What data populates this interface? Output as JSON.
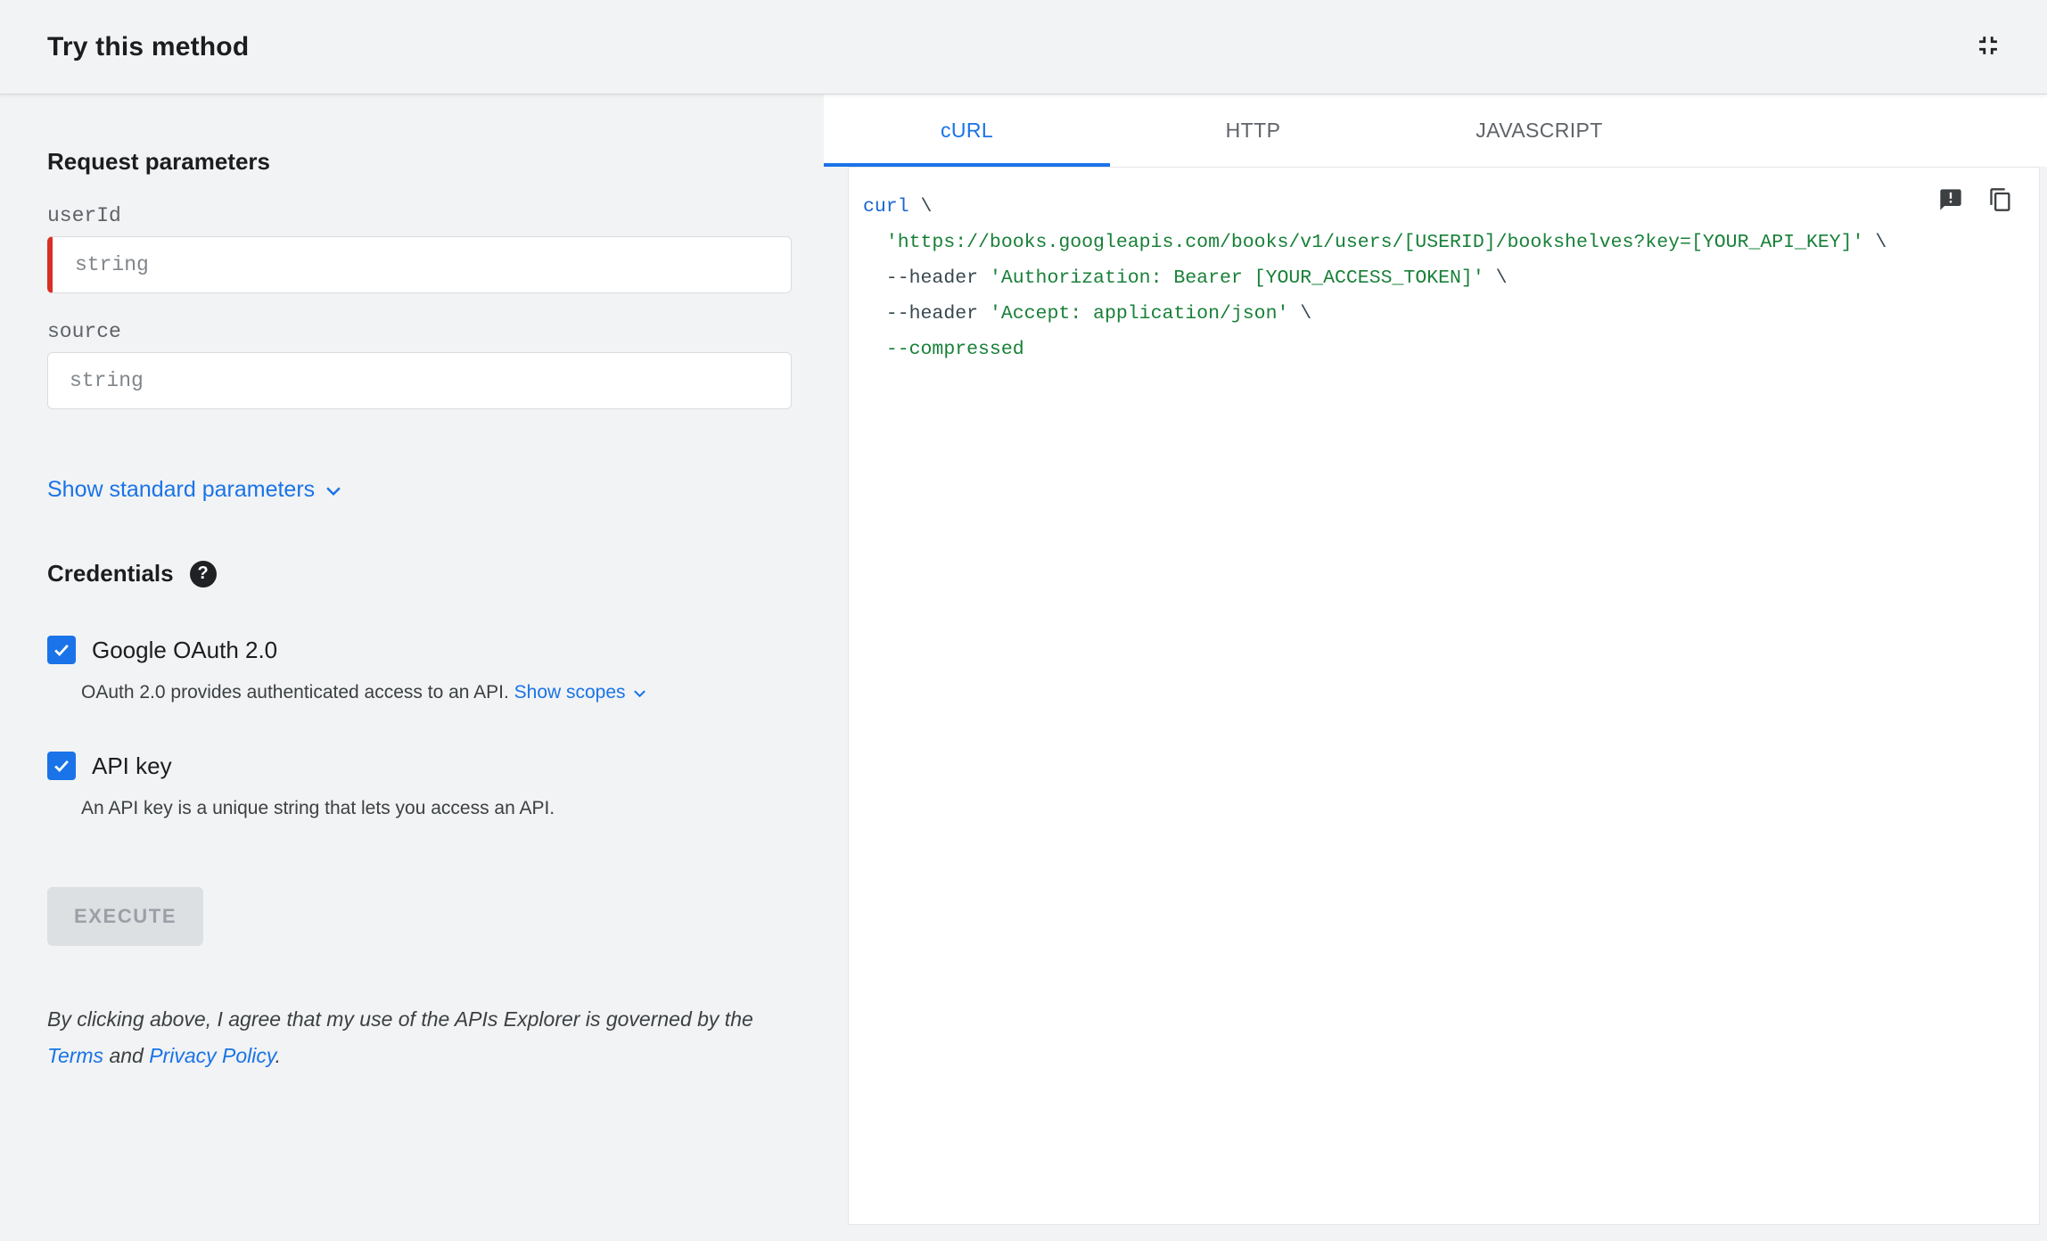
{
  "header": {
    "title": "Try this method"
  },
  "icons": {
    "collapse": "fullscreen-exit-icon",
    "help": "help-circle-icon",
    "feedback": "feedback-icon",
    "copy": "copy-icon",
    "chevron": "chevron-down-icon",
    "checkbox_checked": "checkbox-checked-icon"
  },
  "left": {
    "request_heading": "Request parameters",
    "fields": [
      {
        "label": "userId",
        "placeholder": "string",
        "required": true
      },
      {
        "label": "source",
        "placeholder": "string",
        "required": false
      }
    ],
    "show_standard_label": "Show standard parameters",
    "credentials_heading": "Credentials",
    "oauth": {
      "label": "Google OAuth 2.0",
      "checked": true,
      "description": "OAuth 2.0 provides authenticated access to an API. ",
      "show_scopes_label": "Show scopes"
    },
    "api_key": {
      "label": "API key",
      "checked": true,
      "description": "An API key is a unique string that lets you access an API."
    },
    "execute_label": "EXECUTE",
    "execute_disabled": true,
    "disclaimer": {
      "part1": "By clicking above, I agree that my use of the APIs Explorer is governed by the ",
      "terms": "Terms",
      "part2": " and ",
      "privacy": "Privacy Policy",
      "part3": "."
    }
  },
  "tabs": [
    {
      "label": "cURL",
      "active": true
    },
    {
      "label": "HTTP",
      "active": false
    },
    {
      "label": "JAVASCRIPT",
      "active": false
    }
  ],
  "code": {
    "lines": [
      [
        {
          "t": "curl",
          "c": "kw"
        },
        {
          "t": " \\",
          "c": "pln"
        }
      ],
      [
        {
          "t": "  ",
          "c": "pln"
        },
        {
          "t": "'https://books.googleapis.com/books/v1/users/[USERID]/bookshelves?key=[YOUR_API_KEY]'",
          "c": "str"
        },
        {
          "t": " \\",
          "c": "pln"
        }
      ],
      [
        {
          "t": "  --header ",
          "c": "pln"
        },
        {
          "t": "'Authorization: Bearer [YOUR_ACCESS_TOKEN]'",
          "c": "str"
        },
        {
          "t": " \\",
          "c": "pln"
        }
      ],
      [
        {
          "t": "  --header ",
          "c": "pln"
        },
        {
          "t": "'Accept: application/json'",
          "c": "str"
        },
        {
          "t": " \\",
          "c": "pln"
        }
      ],
      [
        {
          "t": "  ",
          "c": "pln"
        },
        {
          "t": "--compressed",
          "c": "str"
        }
      ]
    ]
  },
  "colors": {
    "accent_blue": "#1a73e8",
    "code_keyword": "#1967d2",
    "code_string": "#188038",
    "code_plain": "#37474f",
    "required_red": "#d93025"
  }
}
